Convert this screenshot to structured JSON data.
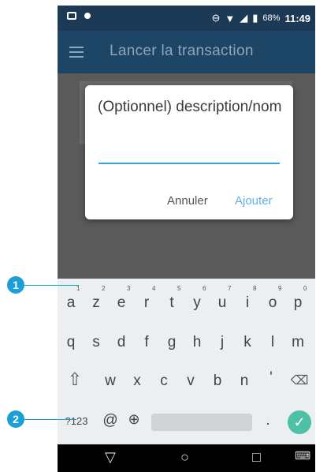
{
  "status_bar": {
    "battery": "68%",
    "time": "11:49"
  },
  "app_bar": {
    "title": "Lancer la transaction"
  },
  "dialog": {
    "title": "(Optionnel) description/nom",
    "input_value": "",
    "cancel_label": "Annuler",
    "add_label": "Ajouter"
  },
  "keyboard": {
    "row1": [
      "a",
      "z",
      "e",
      "r",
      "t",
      "y",
      "u",
      "i",
      "o",
      "p"
    ],
    "row1_hints": [
      "1",
      "2",
      "3",
      "4",
      "5",
      "6",
      "7",
      "8",
      "9",
      "0"
    ],
    "row2": [
      "q",
      "s",
      "d",
      "f",
      "g",
      "h",
      "j",
      "k",
      "l",
      "m"
    ],
    "row3": [
      "w",
      "x",
      "c",
      "v",
      "b",
      "n",
      "'"
    ],
    "symbols_key": "?123",
    "at_key": "@",
    "period_key": "."
  },
  "callouts": [
    "1",
    "2"
  ],
  "colors": {
    "accent": "#3aa1d8",
    "callout": "#1a9fd6",
    "app_bar": "#1d4566"
  }
}
